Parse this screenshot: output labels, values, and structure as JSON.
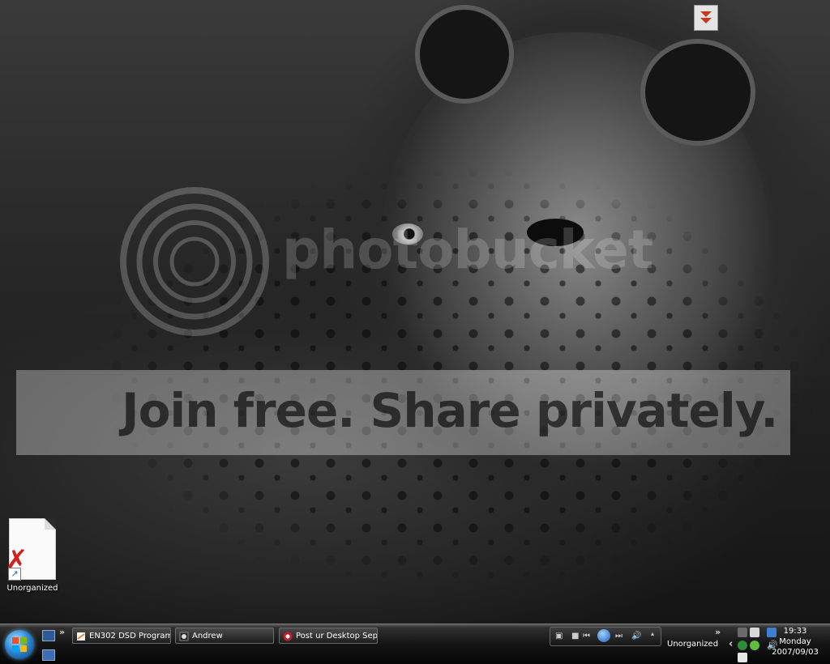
{
  "watermark": {
    "brand": "photobucket",
    "tagline": "Join free. Share privately."
  },
  "desktop_icons": [
    {
      "label": "Unorganized",
      "icon": "broken-document-icon"
    }
  ],
  "taskbar": {
    "overflow_chevron": "»",
    "buttons": [
      {
        "label": "EN302 DSD Program...",
        "icon": "document-icon"
      },
      {
        "label": "Andrew",
        "icon": "messenger-icon"
      },
      {
        "label": "Post ur Desktop Sep...",
        "icon": "browser-icon"
      }
    ],
    "toolbar_label": "Unorganized",
    "tray_chevron": "‹",
    "clock": {
      "time": "19:33",
      "day": "Monday",
      "date": "2007/09/03"
    }
  },
  "colors": {
    "accent_download": "#c8381c",
    "start_orb": "#2f8ad8"
  }
}
